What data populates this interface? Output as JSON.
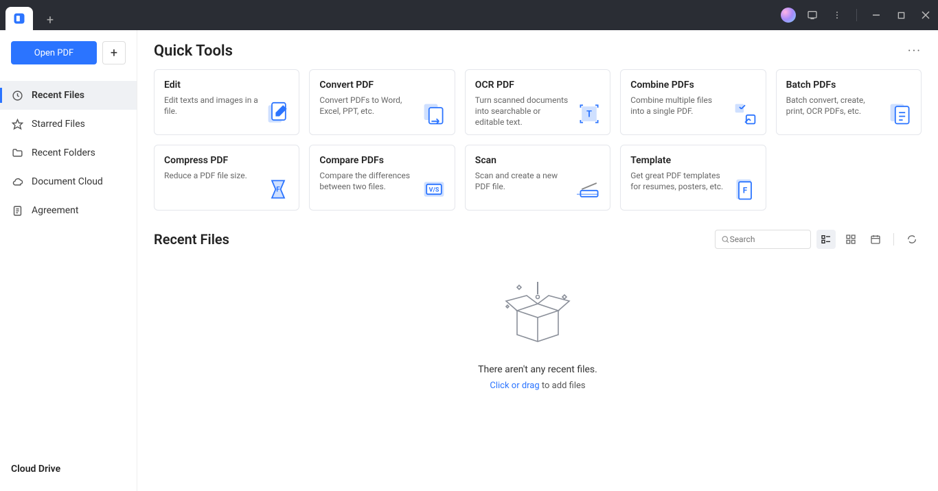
{
  "titlebar": {
    "new_tab": "+"
  },
  "sidebar": {
    "open_label": "Open PDF",
    "plus": "+",
    "items": [
      {
        "label": "Recent Files"
      },
      {
        "label": "Starred Files"
      },
      {
        "label": "Recent Folders"
      },
      {
        "label": "Document Cloud"
      },
      {
        "label": "Agreement"
      }
    ],
    "cloud_drive": "Cloud Drive"
  },
  "quick_tools": {
    "title": "Quick Tools",
    "more": "···",
    "cards": [
      {
        "title": "Edit",
        "desc": "Edit texts and images in a file."
      },
      {
        "title": "Convert PDF",
        "desc": "Convert PDFs to Word, Excel, PPT, etc."
      },
      {
        "title": "OCR PDF",
        "desc": "Turn scanned documents into searchable or editable text."
      },
      {
        "title": "Combine PDFs",
        "desc": "Combine multiple files into a single PDF."
      },
      {
        "title": "Batch PDFs",
        "desc": "Batch convert, create, print, OCR PDFs, etc."
      },
      {
        "title": "Compress PDF",
        "desc": "Reduce a PDF file size."
      },
      {
        "title": "Compare PDFs",
        "desc": "Compare the differences between two files."
      },
      {
        "title": "Scan",
        "desc": "Scan and create a new PDF file."
      },
      {
        "title": "Template",
        "desc": "Get great PDF templates for resumes, posters, etc."
      }
    ]
  },
  "recent": {
    "title": "Recent Files",
    "search_placeholder": "Search",
    "empty_msg": "There aren't any recent files.",
    "empty_link": "Click or drag",
    "empty_rest": " to add files"
  }
}
